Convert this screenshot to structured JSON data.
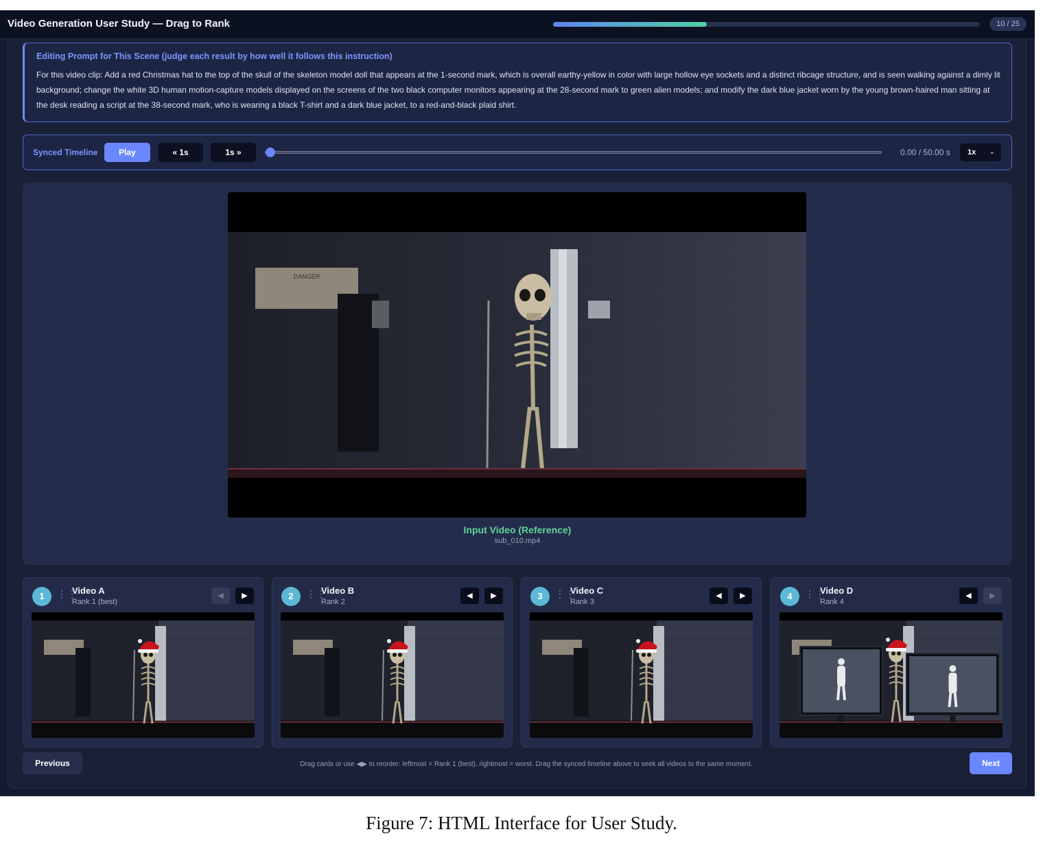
{
  "header": {
    "title": "Video Generation User Study — Drag to Rank",
    "progress_fraction": 0.36,
    "progress_label": "10 / 25"
  },
  "prompt": {
    "heading": "Editing Prompt for This Scene (judge each result by how well it follows this instruction)",
    "text": "For this video clip: Add a red Christmas hat to the top of the skull of the skeleton model doll that appears at the 1-second mark, which is overall earthy-yellow in color with large hollow eye sockets and a distinct ribcage structure, and is seen walking against a dimly lit background; change the white 3D human motion-capture models displayed on the screens of the two black computer monitors appearing at the 28-second mark to green alien models; and modify the dark blue jacket worn by the young brown-haired man sitting at the desk reading a script at the 38-second mark, who is wearing a black T-shirt and a dark blue jacket, to a red-and-black plaid shirt."
  },
  "timeline": {
    "label": "Synced Timeline",
    "play_label": "Play",
    "back_label": "« 1s",
    "forward_label": "1s »",
    "position_fraction": 0.0,
    "time_display": "0.00 / 50.00 s",
    "speed_value": "1x"
  },
  "reference": {
    "title": "Input Video (Reference)",
    "filename": "sub_010.mp4",
    "sign_text": "DANGER"
  },
  "cards": [
    {
      "rank_number": "1",
      "title": "Video A",
      "rank_label": "Rank 1 (best)",
      "left_enabled": false,
      "right_enabled": true,
      "scene": "hat"
    },
    {
      "rank_number": "2",
      "title": "Video B",
      "rank_label": "Rank 2",
      "left_enabled": true,
      "right_enabled": true,
      "scene": "hat"
    },
    {
      "rank_number": "3",
      "title": "Video C",
      "rank_label": "Rank 3",
      "left_enabled": true,
      "right_enabled": true,
      "scene": "hat"
    },
    {
      "rank_number": "4",
      "title": "Video D",
      "rank_label": "Rank 4",
      "left_enabled": true,
      "right_enabled": false,
      "scene": "monitors"
    }
  ],
  "icons": {
    "drag_handle": "drag-handle-icon",
    "arrow_left": "arrow-left-icon",
    "arrow_right": "arrow-right-icon",
    "speed_chevron": "chevron-down-icon"
  },
  "footer": {
    "previous_label": "Previous",
    "next_label": "Next",
    "hint": "Drag cards or use ◀▶ to reorder: leftmost = Rank 1 (best), rightmost = worst. Drag the synced timeline above to seek all videos to the same moment."
  },
  "caption": "Figure 7: HTML Interface for User Study.",
  "colors": {
    "accent": "#6a87ff",
    "reference_title": "#5fd39a",
    "rank_circle": "#5cb8d5",
    "hat_red": "#c8141c"
  }
}
